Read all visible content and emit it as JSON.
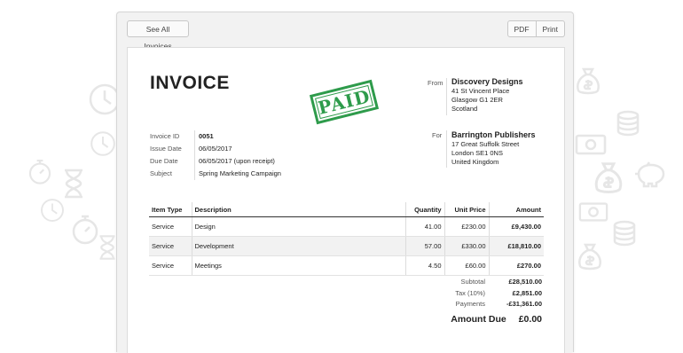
{
  "toolbar": {
    "see_all_label": "See All Invoices",
    "pdf_label": "PDF",
    "print_label": "Print"
  },
  "invoice": {
    "title": "INVOICE",
    "stamp": "PAID",
    "from": {
      "label": "From",
      "name": "Discovery Designs",
      "lines": [
        "41 St Vincent Place",
        "Glasgow G1 2ER",
        "Scotland"
      ]
    },
    "for": {
      "label": "For",
      "name": "Barrington Publishers",
      "lines": [
        "17 Great Suffolk Street",
        "London SE1 0NS",
        "United Kingdom"
      ]
    },
    "meta": [
      {
        "label": "Invoice ID",
        "value": "0051"
      },
      {
        "label": "Issue Date",
        "value": "06/05/2017"
      },
      {
        "label": "Due Date",
        "value": "06/05/2017 (upon receipt)"
      },
      {
        "label": "Subject",
        "value": "Spring Marketing Campaign"
      }
    ],
    "columns": {
      "item_type": "Item Type",
      "description": "Description",
      "quantity": "Quantity",
      "unit_price": "Unit Price",
      "amount": "Amount"
    },
    "items": [
      {
        "type": "Service",
        "description": "Design",
        "quantity": "41.00",
        "unit_price": "£230.00",
        "amount": "£9,430.00"
      },
      {
        "type": "Service",
        "description": "Development",
        "quantity": "57.00",
        "unit_price": "£330.00",
        "amount": "£18,810.00"
      },
      {
        "type": "Service",
        "description": "Meetings",
        "quantity": "4.50",
        "unit_price": "£60.00",
        "amount": "£270.00"
      }
    ],
    "totals": [
      {
        "label": "Subtotal",
        "value": "£28,510.00"
      },
      {
        "label": "Tax (10%)",
        "value": "£2,851.00"
      },
      {
        "label": "Payments",
        "value": "-£31,361.00"
      }
    ],
    "amount_due": {
      "label": "Amount Due",
      "value": "£0.00"
    }
  },
  "colors": {
    "stamp": "#2e9b4b",
    "background_icons": "#e6e6e6"
  },
  "background_icons": [
    "clock-icon",
    "stopwatch-icon",
    "hourglass-icon",
    "money-bag-icon",
    "coins-icon",
    "piggy-bank-icon",
    "banknote-icon"
  ]
}
